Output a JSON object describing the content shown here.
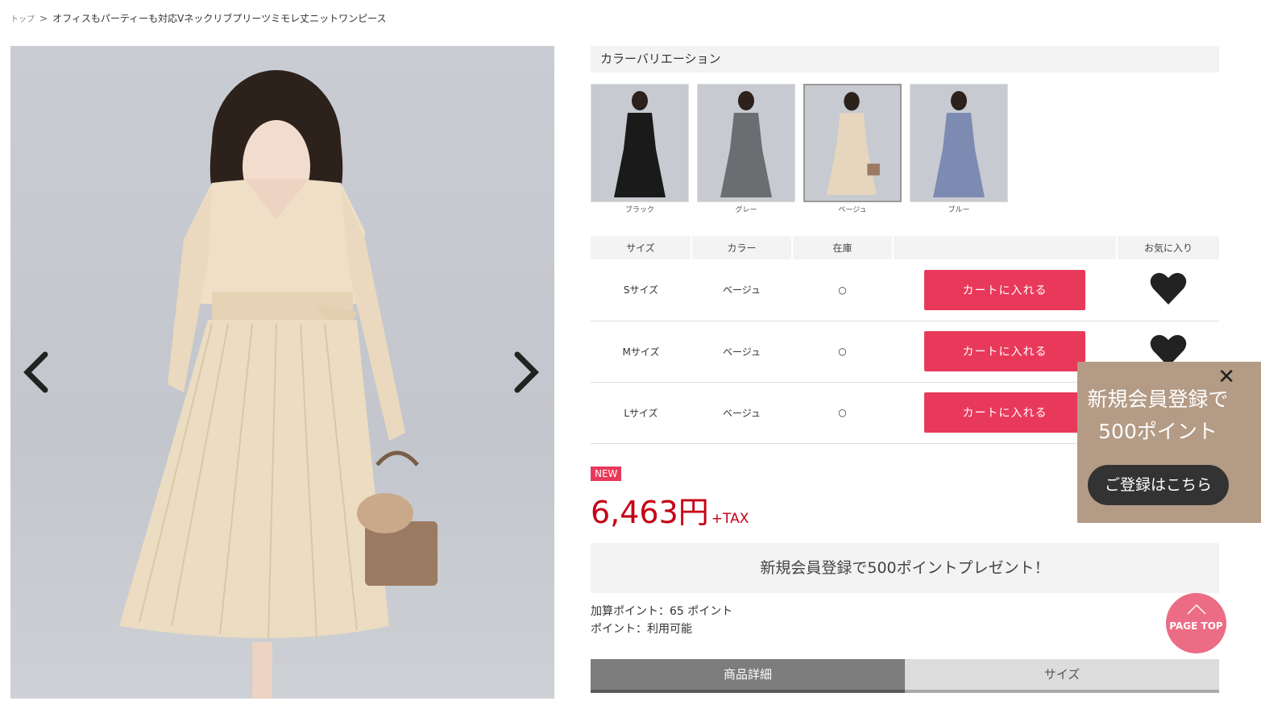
{
  "breadcrumb": {
    "home": "トップ",
    "separator": ">",
    "current": "オフィスもパーティーも対応Vネックリブプリーツミモレ丈ニットワンピース"
  },
  "color_variation": {
    "header": "カラーバリエーション",
    "items": [
      {
        "label": "ブラック",
        "color": "#1a1a1a"
      },
      {
        "label": "グレー",
        "color": "#6b6d70"
      },
      {
        "label": "ベージュ",
        "color": "#e6d6bd"
      },
      {
        "label": "ブルー",
        "color": "#7d8bb3"
      }
    ],
    "selected": "ベージュ"
  },
  "stock_table": {
    "headers": [
      "サイズ",
      "カラー",
      "在庫",
      "",
      "お気に入り"
    ],
    "rows": [
      {
        "size": "Sサイズ",
        "color": "ベージュ",
        "stock": "○",
        "button": "カートに入れる"
      },
      {
        "size": "Mサイズ",
        "color": "ベージュ",
        "stock": "○",
        "button": "カートに入れる"
      },
      {
        "size": "Lサイズ",
        "color": "ベージュ",
        "stock": "○",
        "button": "カートに入れる"
      }
    ]
  },
  "badge": "NEW",
  "price": {
    "amount": "6,463円",
    "tax": "+TAX"
  },
  "promo_bar": "新規会員登録で500ポイントプレゼント！",
  "points": {
    "added": "加算ポイント：65 ポイント",
    "usable": "ポイント：利用可能"
  },
  "tabs": [
    {
      "label": "商品詳細"
    },
    {
      "label": "サイズ"
    }
  ],
  "popup": {
    "close": "✕",
    "line1": "新規会員登録で",
    "line2": "500ポイント",
    "button": "ご登録はこちら"
  },
  "page_top": {
    "label": "PAGE TOP"
  },
  "colors": {
    "accent": "#e8395b",
    "price": "#c40016",
    "popup_bg": "#b39b85",
    "page_top": "#ec6c86"
  }
}
